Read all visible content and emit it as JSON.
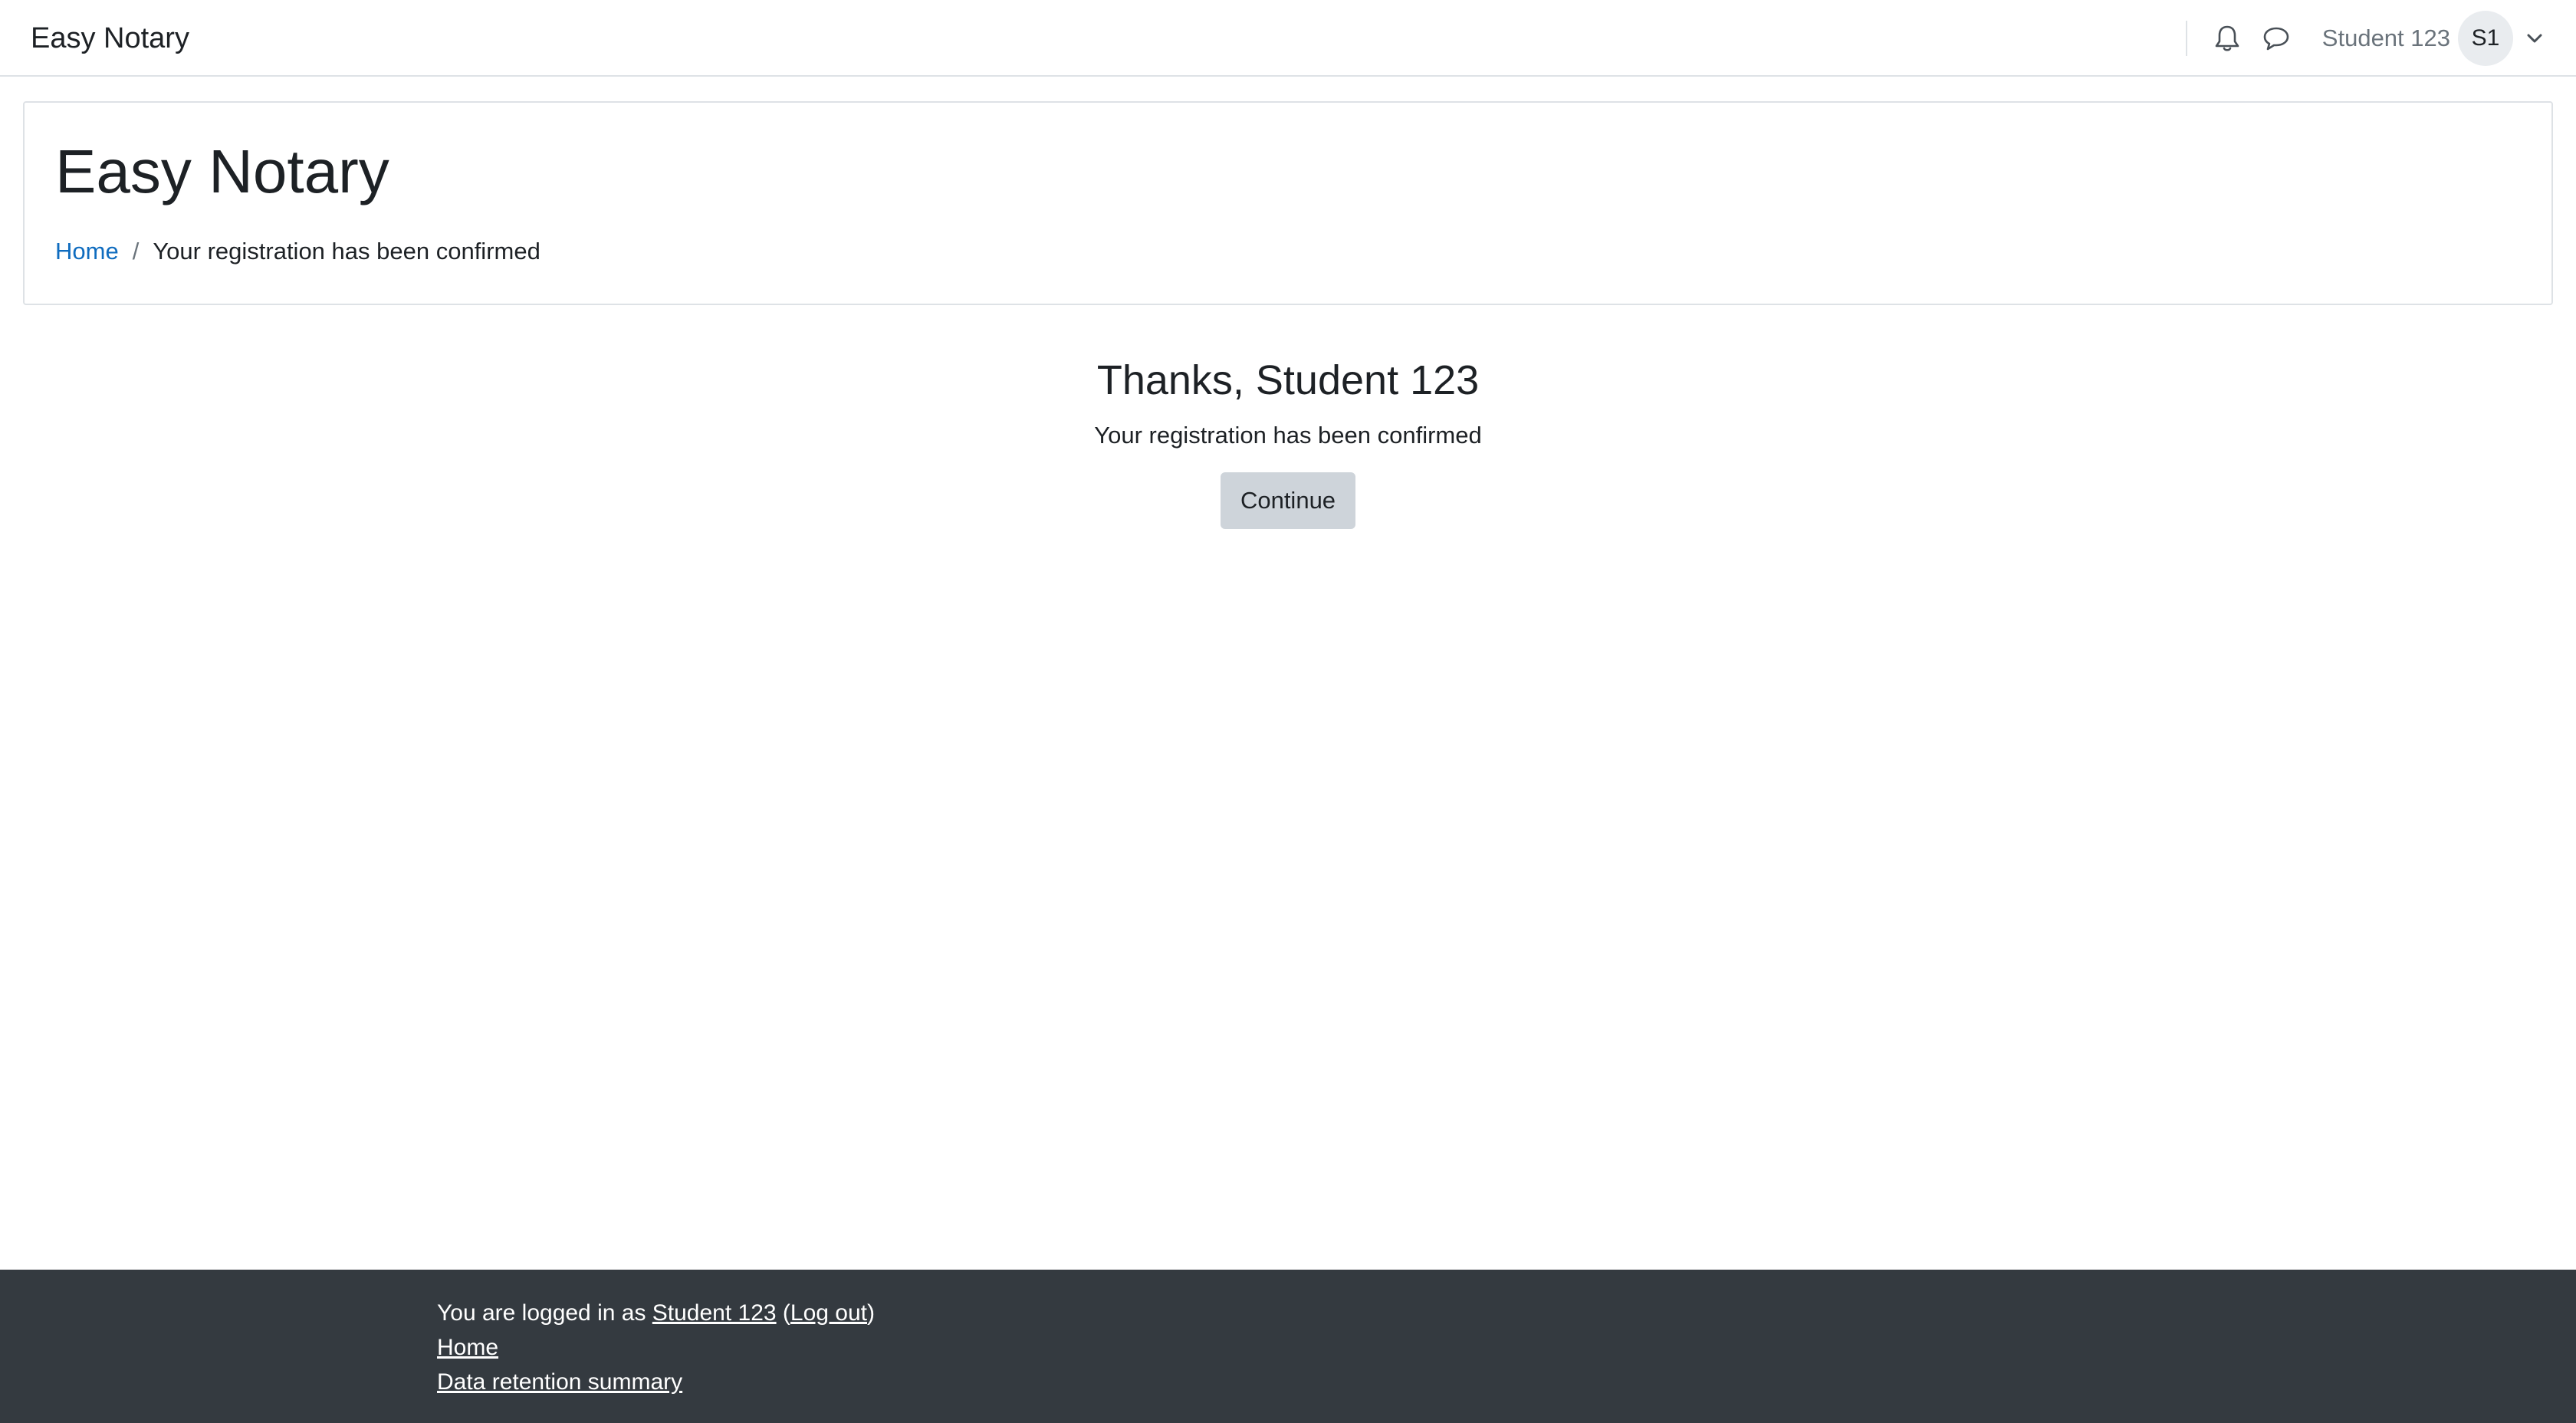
{
  "navbar": {
    "brand": "Easy Notary",
    "user_name": "Student 123",
    "avatar_initials": "S1",
    "icons": [
      "bell-icon",
      "chat-icon",
      "chevron-down-icon"
    ]
  },
  "page_header": {
    "title": "Easy Notary",
    "breadcrumb": {
      "home": "Home",
      "separator": "/",
      "current": "Your registration has been confirmed"
    }
  },
  "main": {
    "heading": "Thanks, Student 123",
    "message": "Your registration has been confirmed",
    "continue_label": "Continue"
  },
  "footer": {
    "logged_in_prefix": "You are logged in as ",
    "user_link": "Student 123",
    "open_paren": " (",
    "logout_link": "Log out",
    "close_paren": ")",
    "home_link": "Home",
    "data_retention_link": "Data retention summary"
  },
  "colors": {
    "link": "#0f6cbf",
    "footer_bg": "#343a40",
    "button_bg": "#ced4da",
    "border": "#dee2e6"
  }
}
